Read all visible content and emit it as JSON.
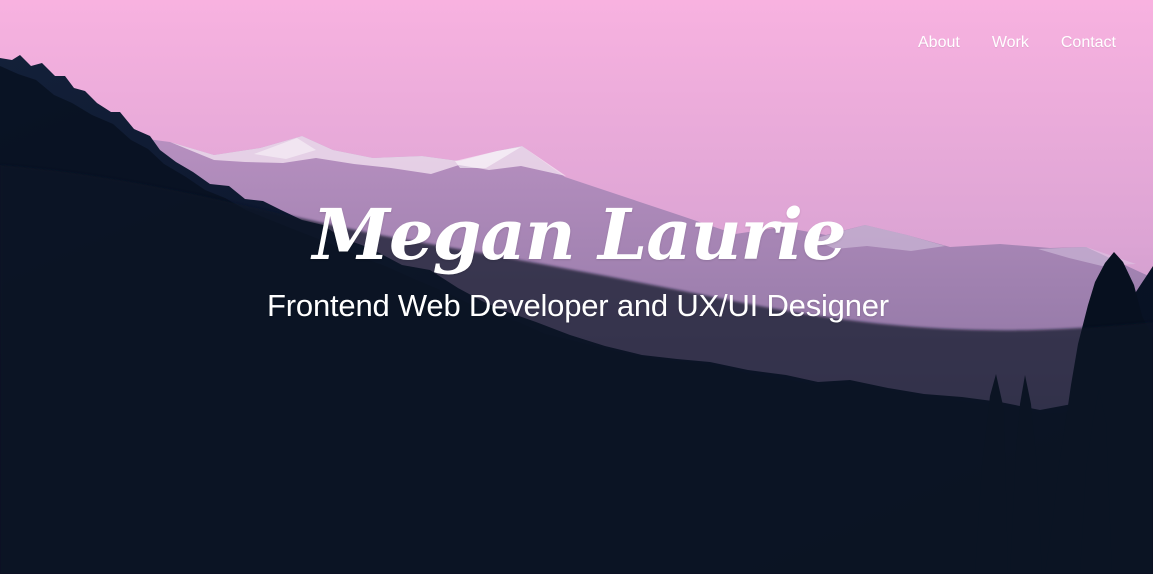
{
  "nav": {
    "items": [
      {
        "label": "About"
      },
      {
        "label": "Work"
      },
      {
        "label": "Contact"
      }
    ]
  },
  "hero": {
    "title": "Megan Laurie",
    "subtitle": "Frontend Web Developer and UX/UI Designer"
  },
  "colors": {
    "sky_top": "#f8b2e0",
    "sky_mid": "#d19ac9",
    "forest": "#071024",
    "mountains_far": "#a77fb0",
    "text": "#ffffff"
  }
}
